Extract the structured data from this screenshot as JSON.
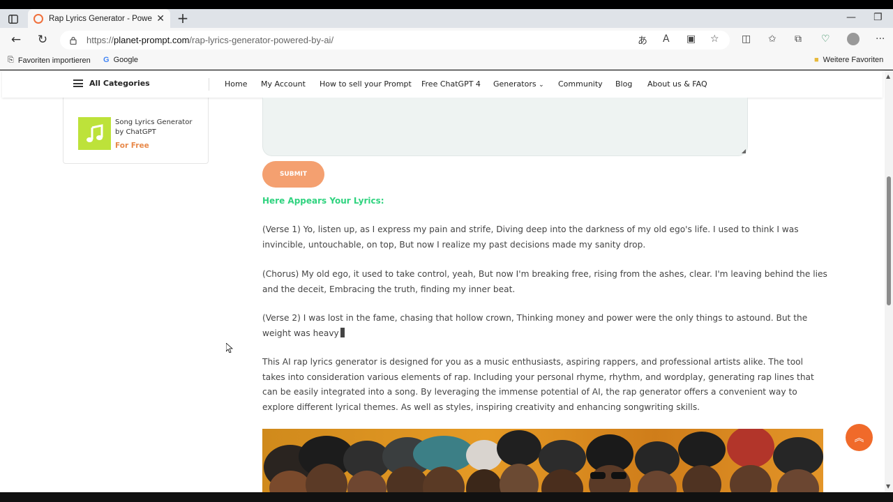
{
  "browser": {
    "tab_title": "Rap Lyrics Generator - Powered By AI",
    "url_scheme": "https://",
    "url_host": "planet-prompt.com",
    "url_path": "/rap-lyrics-generator-powered-by-ai/",
    "bookmarks": {
      "import": "Favoriten importieren",
      "google": "Google",
      "more": "Weitere Favoriten"
    }
  },
  "header": {
    "all_categories": "All Categories",
    "nav": [
      "Home",
      "My Account",
      "How to sell your Prompt",
      "Free ChatGPT 4",
      "Generators",
      "Community",
      "Blog",
      "About us & FAQ"
    ],
    "generators_caret": "⌄"
  },
  "sidebar": {
    "card_title": "Song Lyrics Generator by ChatGPT",
    "card_price": "For Free"
  },
  "main": {
    "submit_label": "SUBMIT",
    "lyrics_heading": "Here Appears Your Lyrics:",
    "verse1": "(Verse 1) Yo, listen up, as I express my pain and strife, Diving deep into the darkness of my old ego's life. I used to think I was invincible, untouchable, on top, But now I realize my past decisions made my sanity drop.",
    "chorus": "(Chorus) My old ego, it used to take control, yeah, But now I'm breaking free, rising from the ashes, clear. I'm leaving behind the lies and the deceit, Embracing the truth, finding my inner beat.",
    "verse2": "(Verse 2) I was lost in the fame, chasing that hollow crown, Thinking money and power were the only things to astound. But the weight was heavy",
    "description": "This AI rap lyrics generator is designed for you as a music enthusiasts, aspiring rappers, and professional artists alike. The tool takes into consideration various elements of rap. Including your personal rhyme, rhythm, and wordplay, generating rap lines that can be easily integrated into a song. By leveraging the immense potential of AI, the rap generator offers a convenient way to explore different lyrical themes. As well as styles, inspiring creativity and enhancing songwriting skills."
  },
  "colors": {
    "accent_orange": "#f06a2a",
    "submit_bg": "#f4a070",
    "heading_green": "#2fd37f",
    "song_thumb": "#bde23a"
  }
}
